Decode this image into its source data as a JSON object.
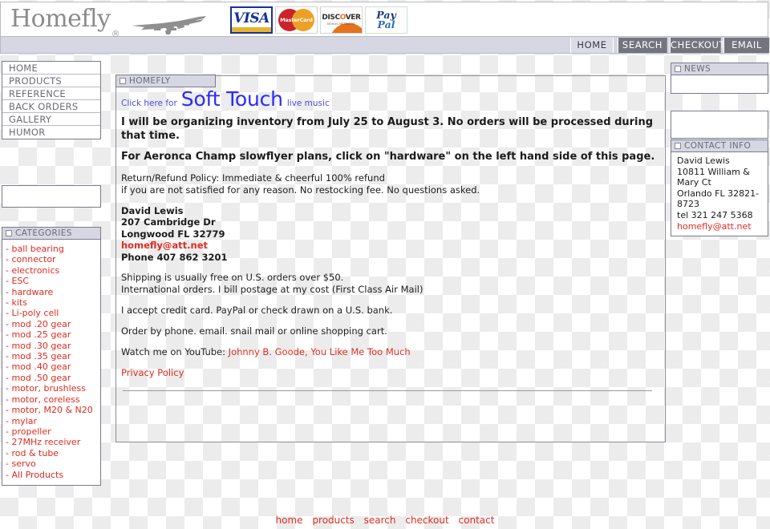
{
  "site": {
    "logo_text": "Homefly",
    "registered_mark": "®"
  },
  "payment_logos": [
    {
      "name": "visa",
      "word": "VISA"
    },
    {
      "name": "mastercard",
      "word": "MasterCard"
    },
    {
      "name": "discover",
      "word": "DISC",
      "word2": "VER",
      "sub": "NOVUS NETWORK"
    },
    {
      "name": "paypal",
      "line1": "Pay",
      "line2": "Pal"
    }
  ],
  "topnav": {
    "tabs": [
      {
        "label": "HOME",
        "active": true
      },
      {
        "label": "SEARCH",
        "active": false
      },
      {
        "label": "CHECKOUT",
        "active": false
      },
      {
        "label": "EMAIL",
        "active": false
      }
    ]
  },
  "sidebar": {
    "nav_items": [
      {
        "label": "HOME"
      },
      {
        "label": "PRODUCTS"
      },
      {
        "label": "REFERENCE"
      },
      {
        "label": "BACK ORDERS"
      },
      {
        "label": "GALLERY"
      },
      {
        "label": "HUMOR"
      }
    ],
    "search_box_value": "",
    "categories_title": "CATEGORIES",
    "categories": [
      "ball bearing",
      "connector",
      "electronics",
      "ESC",
      "hardware",
      "kits",
      "Li-poly cell",
      "mod .20 gear",
      "mod .25 gear",
      "mod .30 gear",
      "mod .35 gear",
      "mod .40 gear",
      "mod .50 gear",
      "motor, brushless",
      "motor, coreless",
      "motor, M20 & N20",
      "mylar",
      "propeller",
      "27MHz receiver",
      "rod & tube",
      "servo",
      "All Products"
    ]
  },
  "main": {
    "tab_title": "HOMEFLY",
    "promo": {
      "prefix": "Click here for",
      "link": "Soft Touch",
      "suffix": "live music"
    },
    "notice1": "I will be organizing inventory from July 25 to August 3. No orders will be processed during that time.",
    "notice2": "For Aeronca Champ slowflyer plans, click on \"hardware\" on the left hand side of this page.",
    "policy_line1": "Return/Refund Policy: Immediate & cheerful 100% refund",
    "policy_line2": "if you are not satisfied for any reason. No restocking fee. No questions asked.",
    "address": {
      "name": "David Lewis",
      "street": "207 Cambridge Dr",
      "citystate": "Longwood FL 32779",
      "email": "homefly@att.net",
      "phone": "Phone 407 862 3201"
    },
    "shipping_line1": "Shipping is usually free on U.S. orders over $50.",
    "shipping_line2": "International orders. I bill postage at my cost (First Class Air Mail)",
    "payment_text": "I accept credit card. PayPal or check drawn on a U.S. bank.",
    "order_text": "Order by phone. email. snail mail or online shopping cart.",
    "youtube_prefix": "Watch me on YouTube:",
    "youtube_link1": "Johnny B. Goode",
    "youtube_sep": ",",
    "youtube_link2": "You Like Me Too Much",
    "privacy_policy": "Privacy Policy"
  },
  "right_sidebar": {
    "news_title": "NEWS",
    "news_body": "",
    "blank_body": "",
    "contact_title": "CONTACT INFO",
    "contact": {
      "name": "David Lewis",
      "street1": "10811 William &",
      "street2": "Mary Ct",
      "citystate1": "Orlando FL 32821-",
      "citystate2": "8723",
      "tel": "tel 321 247 5368",
      "email": "homefly@att.net"
    }
  },
  "footer": {
    "links": [
      "home",
      "products",
      "search",
      "checkout",
      "contact"
    ]
  },
  "colors": {
    "red_link": "#e02b20",
    "blue_link": "#2a2aff",
    "tab_active_bg": "#dcdce6",
    "tab_inactive_bg": "#74747e",
    "panel_head_bg": "#d6d7e2"
  }
}
